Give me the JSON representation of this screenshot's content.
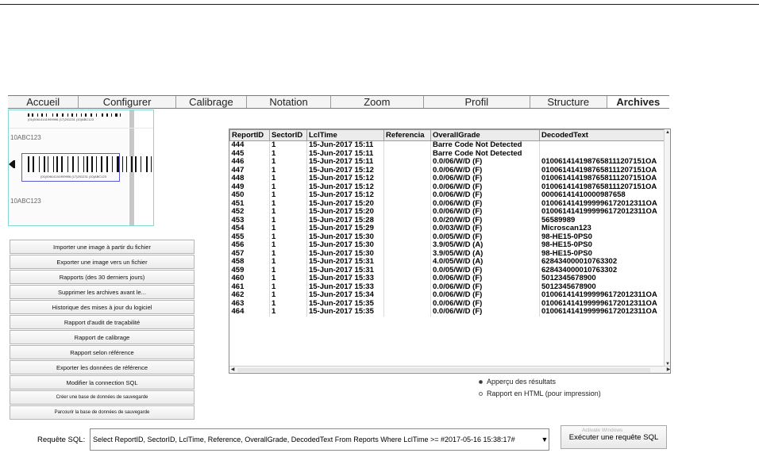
{
  "tabs": [
    {
      "label": "Accueil",
      "width": 98
    },
    {
      "label": "Configurer",
      "width": 134
    },
    {
      "label": "Calibrage",
      "width": 98
    },
    {
      "label": "Notation",
      "width": 116
    },
    {
      "label": "Zoom",
      "width": 128
    },
    {
      "label": "Profil",
      "width": 147
    },
    {
      "label": "Structure",
      "width": 106
    },
    {
      "label": "Archives",
      "width": 86,
      "active": true
    }
  ],
  "preview": {
    "top_text": "(01)00614141999996 (17)201231 (10)ABC123",
    "label_text_1": "10ABC123",
    "label_text_2": "10ABC123",
    "barcode_caption": "(01)00614141999996 (17)201231 (10)ABC123"
  },
  "buttons": [
    "Importer une image à partir du fichier",
    "Exporter une image vers un fichier",
    "Rapports (des 30 derniers jours)",
    "Supprimer les archives avant le...",
    "Historique des mises à jour du logiciel",
    "Rapport d'audit de traçabilité",
    "Rapport de calibrage",
    "Rapport selon référence",
    "Exporter les données de référence",
    "Modifier la connection SQL",
    "Créer une base de données de sauvegarde",
    "Parcourir la base de données de sauvegarde"
  ],
  "table": {
    "headers": [
      "ReportID",
      "SectorID",
      "LclTime",
      "Referencia",
      "OverallGrade",
      "DecodedText"
    ],
    "rows": [
      [
        "444",
        "1",
        "15-Jun-2017 15:11",
        "",
        "Barre Code Not Detected",
        ""
      ],
      [
        "445",
        "1",
        "15-Jun-2017 15:11",
        "",
        "Barre Code Not Detected",
        ""
      ],
      [
        "446",
        "1",
        "15-Jun-2017 15:11",
        "",
        "0.0/06/W/D (F)",
        "0100614141987658111207151OA"
      ],
      [
        "447",
        "1",
        "15-Jun-2017 15:12",
        "",
        "0.0/06/W/D (F)",
        "0100614141987658111207151OA"
      ],
      [
        "448",
        "1",
        "15-Jun-2017 15:12",
        "",
        "0.0/06/W/D (F)",
        "0100614141987658111207151OA"
      ],
      [
        "449",
        "1",
        "15-Jun-2017 15:12",
        "",
        "0.0/06/W/D (F)",
        "0100614141987658111207151OA"
      ],
      [
        "450",
        "1",
        "15-Jun-2017 15:12",
        "",
        "0.0/06/W/D (F)",
        "00006141410000987658"
      ],
      [
        "451",
        "1",
        "15-Jun-2017 15:20",
        "",
        "0.0/06/W/D (F)",
        "0100614141999996172012311OA"
      ],
      [
        "452",
        "1",
        "15-Jun-2017 15:20",
        "",
        "0.0/06/W/D (F)",
        "0100614141999996172012311OA"
      ],
      [
        "453",
        "1",
        "15-Jun-2017 15:28",
        "",
        "0.0/20/W/D (F)",
        "56589989"
      ],
      [
        "454",
        "1",
        "15-Jun-2017 15:29",
        "",
        "0.0/03/W/D (F)",
        "Microscan123"
      ],
      [
        "455",
        "1",
        "15-Jun-2017 15:30",
        "",
        "0.0/05/W/D (F)",
        "98-HE15-0PS0"
      ],
      [
        "456",
        "1",
        "15-Jun-2017 15:30",
        "",
        "3.9/05/W/D (A)",
        "98-HE15-0PS0"
      ],
      [
        "457",
        "1",
        "15-Jun-2017 15:30",
        "",
        "3.9/05/W/D (A)",
        "98-HE15-0PS0"
      ],
      [
        "458",
        "1",
        "15-Jun-2017 15:31",
        "",
        "4.0/05/W/D (A)",
        "628434000010763302"
      ],
      [
        "459",
        "1",
        "15-Jun-2017 15:31",
        "",
        "0.0/05/W/D (F)",
        "628434000010763302"
      ],
      [
        "460",
        "1",
        "15-Jun-2017 15:33",
        "",
        "0.0/06/W/D (F)",
        "5012345678900"
      ],
      [
        "461",
        "1",
        "15-Jun-2017 15:33",
        "",
        "0.0/06/W/D (F)",
        "5012345678900"
      ],
      [
        "462",
        "1",
        "15-Jun-2017 15:34",
        "",
        "0.0/06/W/D (F)",
        "0100614141999996172012311OA"
      ],
      [
        "463",
        "1",
        "15-Jun-2017 15:35",
        "",
        "0.0/06/W/D (F)",
        "0100614141999996172012311OA"
      ],
      [
        "464",
        "1",
        "15-Jun-2017 15:35",
        "",
        "0.0/06/W/D (F)",
        "0100614141999996172012311OA"
      ]
    ]
  },
  "options": {
    "preview_label": "Apperçu des résultats",
    "html_label": "Rapport en HTML (pour impression)",
    "selected": "preview"
  },
  "sql": {
    "label": "Requête SQL:",
    "query": "Select ReportID, SectorID, LclTime, Reference, OverallGrade, DecodedText From Reports Where LclTime >= #2017-05-16 15:38:17#",
    "dropdown_icon": "▼"
  },
  "exec_button": {
    "label": "Exécuter une requête SQL",
    "watermark": "Activate Windows"
  }
}
